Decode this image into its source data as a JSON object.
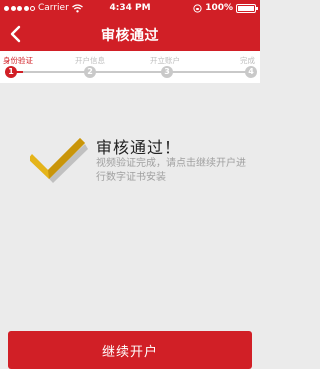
{
  "status_bar": {
    "carrier": "Carrier",
    "time": "4:34 PM",
    "battery": "100%"
  },
  "nav": {
    "title": "审核通过",
    "back_icon": "chevron-left-icon"
  },
  "steps": [
    {
      "label": "身份验证",
      "number": "1",
      "state": "active"
    },
    {
      "label": "开户信息",
      "number": "2",
      "state": "inactive"
    },
    {
      "label": "开立账户",
      "number": "3",
      "state": "inactive"
    },
    {
      "label": "完成",
      "number": "4",
      "state": "inactive"
    }
  ],
  "result": {
    "icon": "checkmark-icon",
    "title": "审核通过！",
    "description": "视频验证完成，请点击继续开户进行数字证书安装"
  },
  "footer": {
    "continue_label": "继续开户"
  },
  "colors": {
    "brand_red": "#d11f26",
    "checkmark_gold": "#e5b419",
    "inactive_gray": "#c9c9c9"
  }
}
